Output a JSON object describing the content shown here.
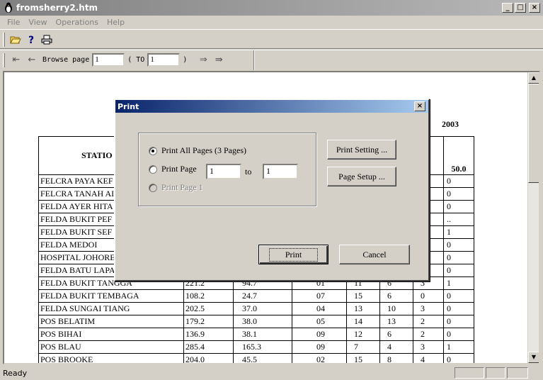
{
  "window": {
    "title": "fromsherry2.htm",
    "buttons": {
      "minimize": "_",
      "maximize": "□",
      "close": "×"
    }
  },
  "menu": {
    "items": [
      {
        "label": "File",
        "hotkey": "F"
      },
      {
        "label": "View",
        "hotkey": "V"
      },
      {
        "label": "Operations",
        "hotkey": "O"
      },
      {
        "label": "Help",
        "hotkey": "H"
      }
    ]
  },
  "toolbar": {
    "icons": [
      "open-folder-icon",
      "help-icon",
      "printer-icon"
    ]
  },
  "browse": {
    "first": "⇤",
    "prev": "←",
    "label": "Browse page",
    "from_value": "1",
    "to_open": "( TO",
    "to_value": "1",
    "to_close": ")",
    "next": "⇒",
    "last": "⇛"
  },
  "document": {
    "year": "2003",
    "header_station": "STATIO",
    "header_ge": "≥",
    "header_col_a": ".0",
    "header_col_b": "50.0",
    "rows": [
      {
        "station": "FELCRA PAYA KEF",
        "c1": "",
        "c2": "",
        "c3": "",
        "c4": "",
        "c5": "",
        "c6": "",
        "c7": "0"
      },
      {
        "station": "FELCRA TANAH AI",
        "c1": "",
        "c2": "",
        "c3": "",
        "c4": "",
        "c5": "",
        "c6": "",
        "c7": "0"
      },
      {
        "station": "FELDA AYER HITA",
        "c1": "",
        "c2": "",
        "c3": "",
        "c4": "",
        "c5": "",
        "c6": "",
        "c7": "0"
      },
      {
        "station": "FELDA BUKIT PEF",
        "c1": "",
        "c2": "",
        "c3": "",
        "c4": "",
        "c5": "",
        "c6": "..",
        "c7": ".."
      },
      {
        "station": "FELDA BUKIT SEF",
        "c1": "",
        "c2": "",
        "c3": "",
        "c4": "",
        "c5": "",
        "c6": "",
        "c7": "1"
      },
      {
        "station": "FELDA MEDOI",
        "c1": "",
        "c2": "",
        "c3": "",
        "c4": "",
        "c5": "",
        "c6": "",
        "c7": "0"
      },
      {
        "station": "HOSPITAL JOHORE",
        "c1": "",
        "c2": "",
        "c3": "",
        "c4": "",
        "c5": "",
        "c6": "",
        "c7": "0"
      },
      {
        "station": "FELDA BATU LAPA",
        "c1": "",
        "c2": "",
        "c3": "",
        "c4": "",
        "c5": "",
        "c6": "",
        "c7": "0"
      },
      {
        "station": "FELDA BUKIT TANGGA",
        "c1": "221.2",
        "c2": "94.7",
        "c3": "01",
        "c4": "11",
        "c5": "6",
        "c6": "3",
        "c7": "1"
      },
      {
        "station": "FELDA BUKIT TEMBAGA",
        "c1": "108.2",
        "c2": "24.7",
        "c3": "07",
        "c4": "15",
        "c5": "6",
        "c6": "0",
        "c7": "0"
      },
      {
        "station": "FELDA SUNGAI TIANG",
        "c1": "202.5",
        "c2": "37.0",
        "c3": "04",
        "c4": "13",
        "c5": "10",
        "c6": "3",
        "c7": "0"
      },
      {
        "station": "POS BELATIM",
        "c1": "179.2",
        "c2": "38.0",
        "c3": "05",
        "c4": "14",
        "c5": "13",
        "c6": "2",
        "c7": "0"
      },
      {
        "station": "POS BIHAI",
        "c1": "136.9",
        "c2": "38.1",
        "c3": "09",
        "c4": "12",
        "c5": "6",
        "c6": "2",
        "c7": "0"
      },
      {
        "station": "POS BLAU",
        "c1": "285.4",
        "c2": "165.3",
        "c3": "09",
        "c4": "7",
        "c5": "4",
        "c6": "3",
        "c7": "1"
      },
      {
        "station": "POS BROOKE",
        "c1": "204.0",
        "c2": "45.5",
        "c3": "02",
        "c4": "15",
        "c5": "8",
        "c6": "4",
        "c7": "0"
      }
    ]
  },
  "status": {
    "text": "Ready"
  },
  "dialog": {
    "title": "Print",
    "close": "×",
    "options": {
      "all_pages": "Print All Pages (3 Pages)",
      "page_range": "Print Page",
      "from_value": "1",
      "to_label": "to",
      "to_value": "1",
      "current_page": "Print Page 1"
    },
    "buttons": {
      "print_setting": "Print Setting ...",
      "page_setup": "Page Setup ...",
      "print": "Print",
      "cancel": "Cancel"
    }
  }
}
